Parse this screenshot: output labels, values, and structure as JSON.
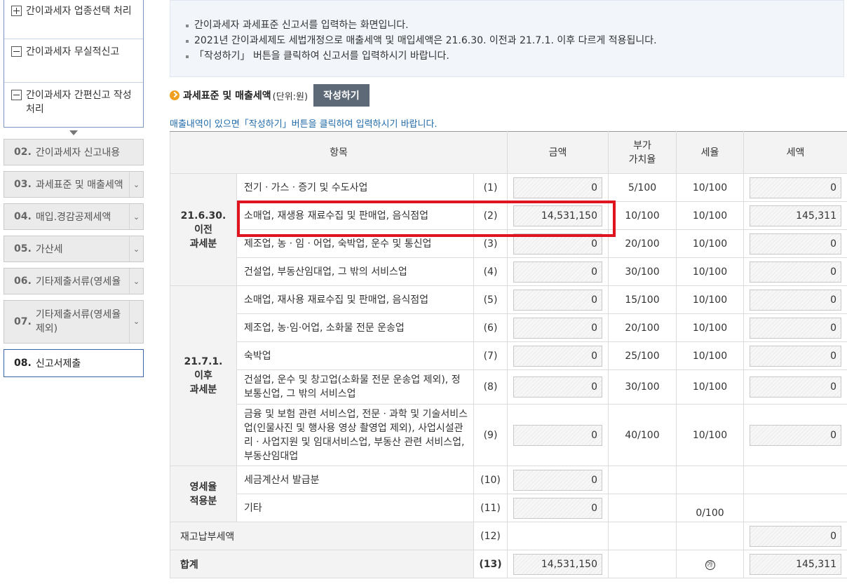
{
  "sidebar": {
    "sub_items": [
      {
        "label": "간이과세자 업종선택 처리",
        "icon": "plus"
      },
      {
        "label": "간이과세자 무실적신고",
        "icon": "minus"
      },
      {
        "label": "간이과세자 간편신고 작성 처리",
        "icon": "minus"
      }
    ],
    "steps": [
      {
        "num": "02.",
        "label": "간이과세자 신고내용"
      },
      {
        "num": "03.",
        "label": "과세표준 및 매출세액"
      },
      {
        "num": "04.",
        "label": "매입.경감공제세액"
      },
      {
        "num": "05.",
        "label": "가산세"
      },
      {
        "num": "06.",
        "label": "기타제출서류(영세율"
      },
      {
        "num": "07.",
        "label": "기타제출서류(영세율 제외)"
      },
      {
        "num": "08.",
        "label": "신고서제출"
      }
    ]
  },
  "notice": [
    "간이과세자 과세표준 신고서를 입력하는 화면입니다.",
    "2021년 간이과세제도 세법개정으로 매출세액 및 매입세액은 21.6.30. 이전과 21.7.1. 이후 다르게 적용됩니다.",
    "「작성하기」 버튼을 클릭하여 신고서를 입력하시기 바랍니다."
  ],
  "section": {
    "title": "과세표준 및 매출세액",
    "unit": "(단위:원)",
    "write_button": "작성하기",
    "hint": "매출내역이 있으면「작성하기」버튼을 클릭하여 입력하시기 바랍니다."
  },
  "table": {
    "headers": {
      "item": "항목",
      "amount": "금액",
      "vat_rate": "부가\n가치율",
      "tax_rate": "세율",
      "tax": "세액"
    },
    "groups": {
      "before": "21.6.30.\n이전\n과세분",
      "after": "21.7.1.\n이후\n과세분",
      "zero": "영세율\n적용분"
    },
    "rows": [
      {
        "item": "전기ㆍ가스ㆍ증기 및 수도사업",
        "no": "(1)",
        "amount": "0",
        "vat_rate": "5/100",
        "tax_rate": "10/100",
        "tax": "0"
      },
      {
        "item": "소매업, 재생용 재료수집 및 판매업, 음식점업",
        "no": "(2)",
        "amount": "14,531,150",
        "vat_rate": "10/100",
        "tax_rate": "10/100",
        "tax": "145,311"
      },
      {
        "item": "제조업, 농ㆍ임ㆍ어업, 숙박업, 운수 및 통신업",
        "no": "(3)",
        "amount": "0",
        "vat_rate": "20/100",
        "tax_rate": "10/100",
        "tax": "0"
      },
      {
        "item": "건설업, 부동산임대업, 그 밖의 서비스업",
        "no": "(4)",
        "amount": "0",
        "vat_rate": "30/100",
        "tax_rate": "10/100",
        "tax": "0"
      },
      {
        "item": "소매업, 재사용 재료수집 및 판매업, 음식점업",
        "no": "(5)",
        "amount": "0",
        "vat_rate": "15/100",
        "tax_rate": "10/100",
        "tax": "0"
      },
      {
        "item": "제조업, 농·임·어업, 소화물 전문 운송업",
        "no": "(6)",
        "amount": "0",
        "vat_rate": "20/100",
        "tax_rate": "10/100",
        "tax": "0"
      },
      {
        "item": "숙박업",
        "no": "(7)",
        "amount": "0",
        "vat_rate": "25/100",
        "tax_rate": "10/100",
        "tax": "0"
      },
      {
        "item": "건설업, 운수 및 창고업(소화물 전문 운송업 제외), 정보통신업, 그 밖의 서비스업",
        "no": "(8)",
        "amount": "0",
        "vat_rate": "30/100",
        "tax_rate": "10/100",
        "tax": "0"
      },
      {
        "item": "금융 및 보험 관련 서비스업, 전문ㆍ과학 및 기술서비스업(인물사진 및 행사용 영상 촬영업 제외), 사업시설관리ㆍ사업지원 및 임대서비스업, 부동산 관련 서비스업, 부동산임대업",
        "no": "(9)",
        "amount": "0",
        "vat_rate": "40/100",
        "tax_rate": "10/100",
        "tax": "0"
      },
      {
        "item": "세금계산서 발급분",
        "no": "(10)",
        "amount": "0"
      },
      {
        "item": "기타",
        "no": "(11)",
        "amount": "0",
        "tax_rate": "0/100"
      }
    ],
    "inventory_row": {
      "label": "재고납부세액",
      "no": "(12)",
      "tax": "0"
    },
    "total_row": {
      "label": "합계",
      "no": "(13)",
      "amount": "14,531,150",
      "mark": "㉮",
      "tax": "145,311"
    }
  },
  "colors": {
    "highlight": "#e0141e",
    "button": "#5e6977",
    "hint": "#1f6aa8",
    "active_step_border": "#3a63a8"
  }
}
